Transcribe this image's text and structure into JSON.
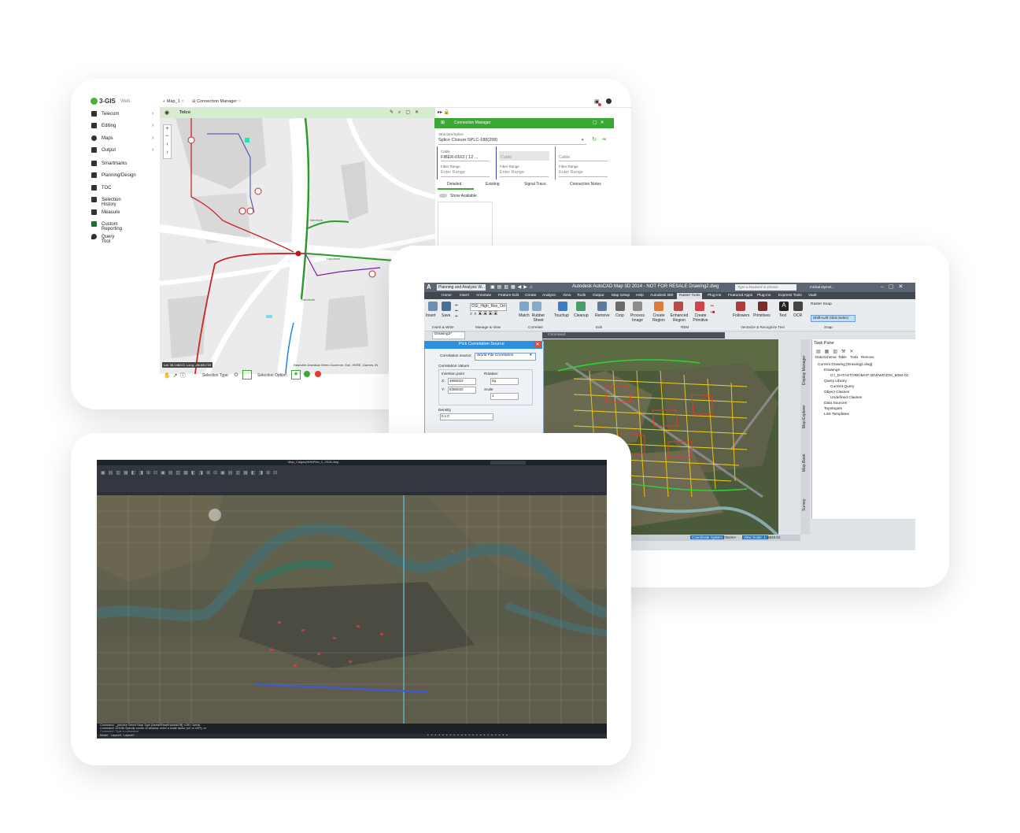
{
  "web_gis": {
    "logo": "3-GIS",
    "logo_suffix": "Web",
    "tabs": [
      "Map_1",
      "Connection Manager"
    ],
    "sidebar": [
      {
        "label": "Telecom",
        "icon": "phone-icon",
        "chevron": true
      },
      {
        "label": "Editing",
        "icon": "pencil-icon",
        "chevron": true
      },
      {
        "label": "Maps",
        "icon": "globe-icon",
        "chevron": true
      },
      {
        "label": "Output",
        "icon": "printer-icon",
        "chevron": true
      },
      {
        "label": "Smartmarks",
        "icon": "bookmark-icon",
        "chevron": false
      },
      {
        "label": "Planning/Design",
        "icon": "design-icon",
        "chevron": false
      },
      {
        "label": "TOC",
        "icon": "layers-icon",
        "chevron": false
      },
      {
        "label": "Selection History",
        "icon": "history-icon",
        "chevron": false
      },
      {
        "label": "Measure",
        "icon": "ruler-icon",
        "chevron": false
      },
      {
        "label": "Custom Reporting",
        "icon": "excel-icon",
        "chevron": false
      },
      {
        "label": "Query Tool",
        "icon": "pin-icon",
        "chevron": false
      }
    ],
    "map_title": "Telco",
    "map_labels": [
      "Handhole",
      "Handhole",
      "Handhole"
    ],
    "coords": "Lat: 36.148213, Long: -86.681733",
    "attribution": "Nashville-Davidson Metro Governm, Esri, HERE, Garmin, IN",
    "selection_type_label": "Selection Type:",
    "selection_option_label": "Selection Option:",
    "connection_manager": {
      "title": "Connection Manager",
      "structure_label": "Structure/Splice",
      "structure_value": "Splice Closure:SPLC-188(298)",
      "cable_label": "Cable",
      "cable_value": "FIBER-0163 ( 12 ...",
      "cable_placeholder": "Cable",
      "fiber_range_label": "Fiber Range",
      "fiber_range_placeholder": "Enter Range",
      "subtabs": [
        "Detailed",
        "Existing",
        "Signal Trace",
        "Connection Notes"
      ],
      "show_available": "Show Available"
    }
  },
  "autocad_map": {
    "window_title": "Autodesk AutoCAD Map 3D 2014 - NOT FOR RESALE    Drawing2.dwg",
    "workspace": "Planning and Analysis W...",
    "search_placeholder": "Type a keyword or phrase",
    "user": "michal.stymet...",
    "menu_tabs": [
      "Home",
      "Insert",
      "Annotate",
      "Feature Edit",
      "Create",
      "Analyze",
      "View",
      "Tools",
      "Output",
      "Map Setup",
      "Help",
      "Autodesk 360",
      "Raster Tools",
      "Plug-ins",
      "Featured Apps",
      "Plug-ins",
      "Express Tools",
      "Vault"
    ],
    "layer_dropdown": "OSI_High_Res_Ort",
    "ribbon_buttons": [
      "Insert",
      "Save",
      "Match",
      "Rubber Sheet",
      "Touchup",
      "Cleanup",
      "Remove",
      "Crop",
      "Process Image",
      "Create Region",
      "Enhanced Region",
      "Create Primitive",
      "Followers",
      "Primitives",
      "Text",
      "OCR"
    ],
    "ribbon_groups": [
      "Insert & Write",
      "Manage & View",
      "Correlate",
      "Edit",
      "REM",
      "Vectorize & Recognize Text",
      "Snap"
    ],
    "raster_snap": "Raster Snap",
    "shift_click": "Shift+Left Click Select",
    "doc_tab": "Drawing2*",
    "dialog": {
      "title": "Pick Correlation Source",
      "source_label": "Correlation source:",
      "source_value": "World File Correlation",
      "values_label": "Correlation Values",
      "insertion_label": "Insertion point",
      "x_label": "X:",
      "x_value": "4986010",
      "y_label": "Y:",
      "y_value": "5386020",
      "rotation_label": "Rotation:",
      "rotation_value": "0g",
      "scale_label": "Scale",
      "scale_value": "1",
      "density_label": "Density",
      "density_value": "0 x 0"
    },
    "command_label": "Command",
    "side_tabs": [
      "Display Manager",
      "Map Explorer",
      "Map Book",
      "Survey"
    ],
    "task_pane": {
      "title": "Task Pane",
      "toolbar": [
        "Data",
        "Schema",
        "Table",
        "Tools",
        "Remove"
      ],
      "tree": [
        "Current Drawing [Drawing2.dwg]",
        "Drawings",
        "C:\\_DATASTORE\\MAP 3D\\DWG\\OSI_6084-01",
        "Query Library",
        "Current Query",
        "Object Classes",
        "Undefined Classes",
        "Data Sources",
        "Topologies",
        "Link Templates"
      ]
    },
    "status": [
      "Coordinate System",
      "<None>",
      "View Scale: 1:",
      "1843.01"
    ]
  },
  "dark_acad": {
    "title_text": "Map_CalgaryWithPlan_2_2018.dwg",
    "command_lines": [
      "Command: _preview Select Map Type [Aerial/Road/Hybrid/Off] <Off>: Aerial",
      "Command: ZOOM Specify corner of window, enter a scale factor (nX or nXP), or",
      "Command: Type a command"
    ],
    "bottom_tabs": [
      "Model",
      "Layout1",
      "Layout2"
    ]
  }
}
